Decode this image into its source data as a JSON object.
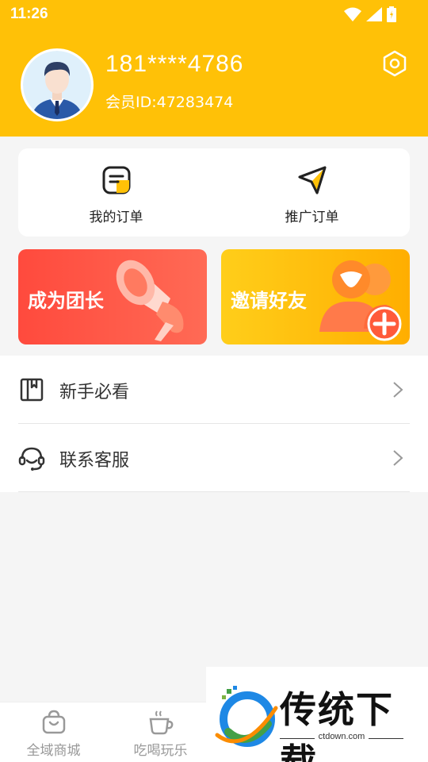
{
  "status_bar": {
    "time": "11:26"
  },
  "profile": {
    "phone": "181****4786",
    "member_id": "会员ID:47283474"
  },
  "orders": [
    {
      "label": "我的订单",
      "icon": "order-list-icon"
    },
    {
      "label": "推广订单",
      "icon": "paper-plane-icon"
    }
  ],
  "promos": [
    {
      "label": "成为团长",
      "icon": "megaphone-icon",
      "color": "#ff4a3d"
    },
    {
      "label": "邀请好友",
      "icon": "add-friend-icon",
      "color": "#ffc107"
    }
  ],
  "menu": [
    {
      "label": "新手必看",
      "icon": "book-icon"
    },
    {
      "label": "联系客服",
      "icon": "headset-icon"
    }
  ],
  "bottom_nav": [
    {
      "label": "全域商城",
      "icon": "shopping-bag-icon"
    },
    {
      "label": "吃喝玩乐",
      "icon": "coffee-cup-icon"
    }
  ],
  "watermark": {
    "title": "传统下载",
    "url": "ctdown.com"
  },
  "colors": {
    "accent": "#ffc107",
    "red": "#ff4a3d",
    "background": "#f5f5f5"
  }
}
